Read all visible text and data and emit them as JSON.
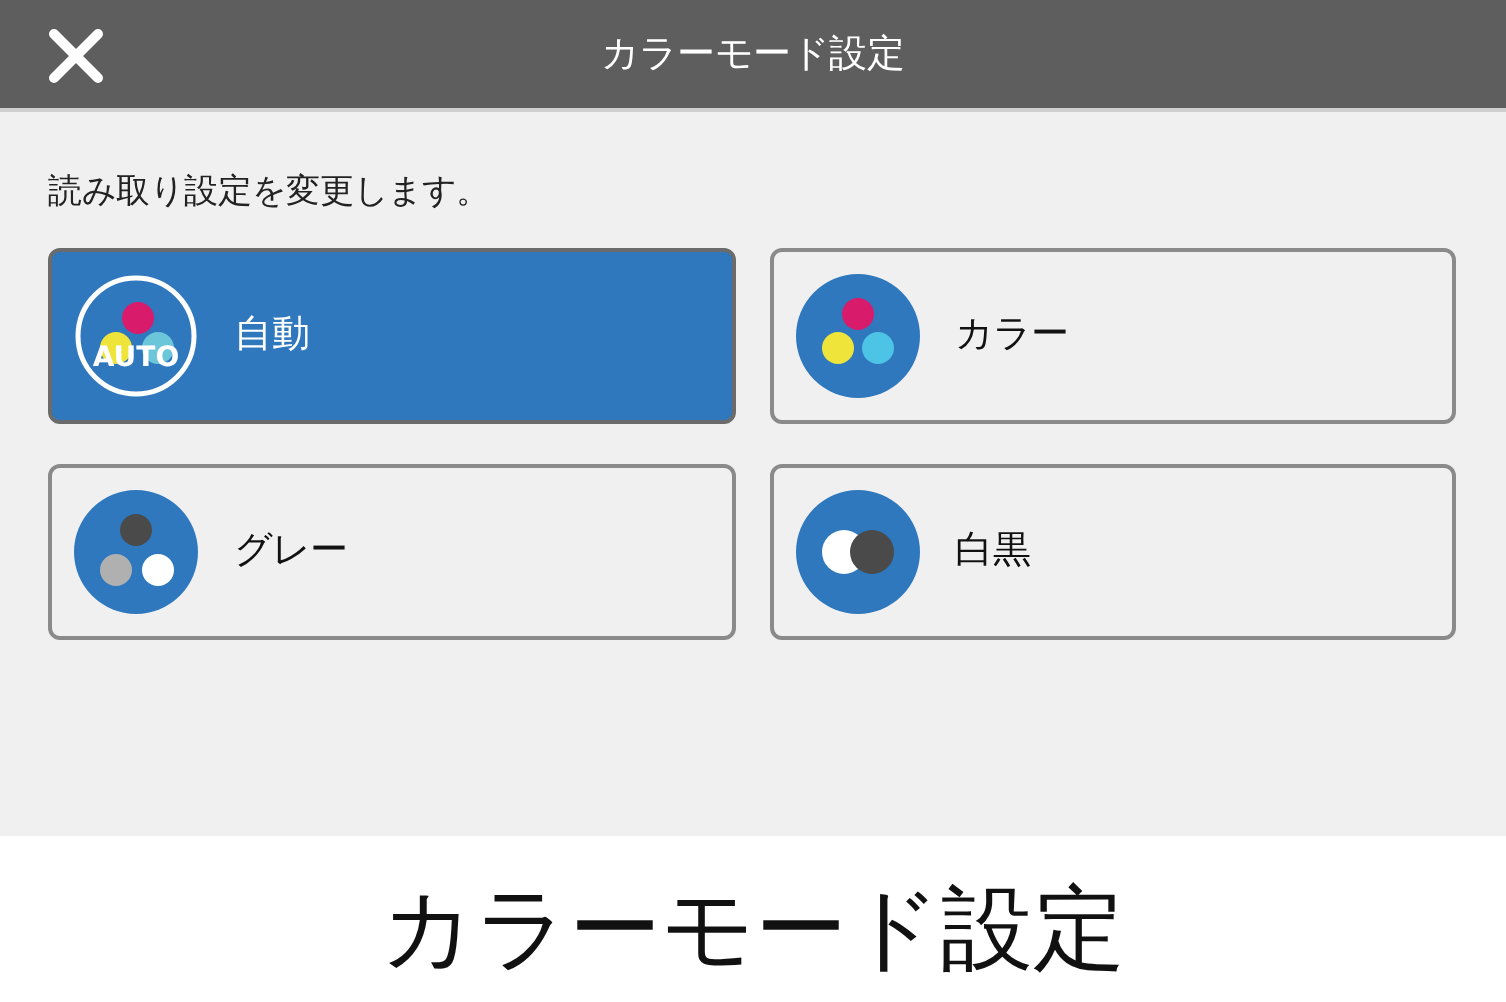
{
  "window": {
    "title": "カラーモード設定"
  },
  "instruction": "読み取り設定を変更します。",
  "options": [
    {
      "kind": "auto",
      "label": "自動",
      "badge": "AUTO",
      "selected": true
    },
    {
      "kind": "color",
      "label": "カラー",
      "selected": false
    },
    {
      "kind": "gray",
      "label": "グレー",
      "selected": false
    },
    {
      "kind": "mono",
      "label": "白黒",
      "selected": false
    }
  ],
  "caption": "カラーモード設定"
}
